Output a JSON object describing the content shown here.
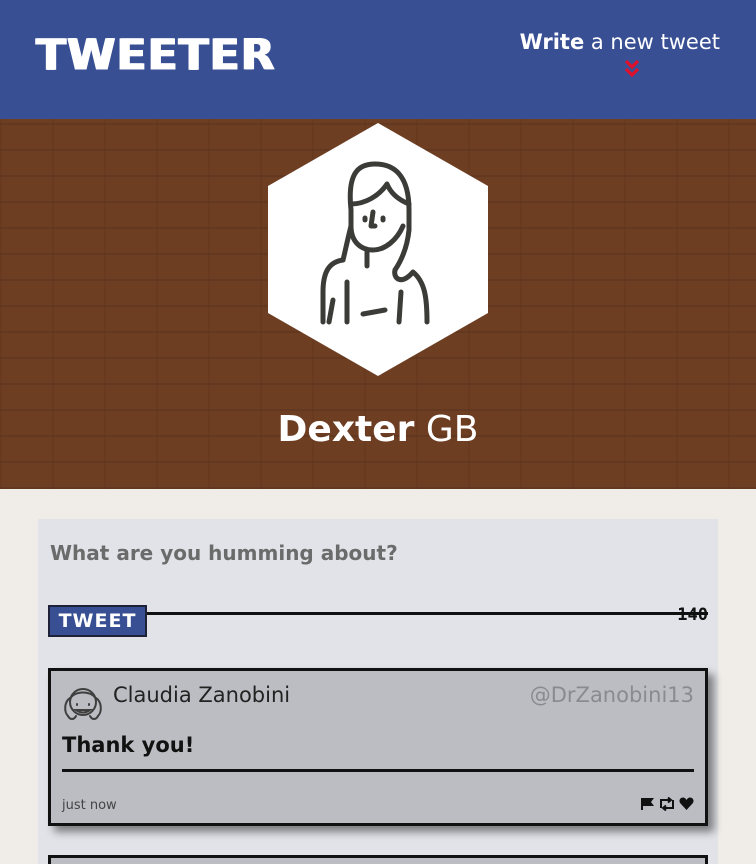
{
  "nav": {
    "logo": "TWEETER",
    "compose_bold": "Write",
    "compose_rest": " a new tweet",
    "compose_icon": "double-chevron-down-icon"
  },
  "profile": {
    "avatar_icon": "user-avatar-illustration",
    "first_name": "Dexter",
    "last_name": " GB"
  },
  "compose": {
    "placeholder": "What are you humming about?",
    "button_label": "TWEET",
    "counter": "140"
  },
  "tweets": [
    {
      "name": "Claudia Zanobini",
      "handle": "@DrZanobini13",
      "content": "Thank you!",
      "time": "just now",
      "actions": [
        "flag-icon",
        "retweet-icon",
        "heart-icon"
      ]
    }
  ],
  "colors": {
    "nav": "#384f93",
    "accent": "#e0102b",
    "header_brick": "#6e3e23",
    "tweet_bg": "#bcbdc3",
    "compose_bg": "#e1e3e8",
    "page_bg": "#f0ede8"
  }
}
